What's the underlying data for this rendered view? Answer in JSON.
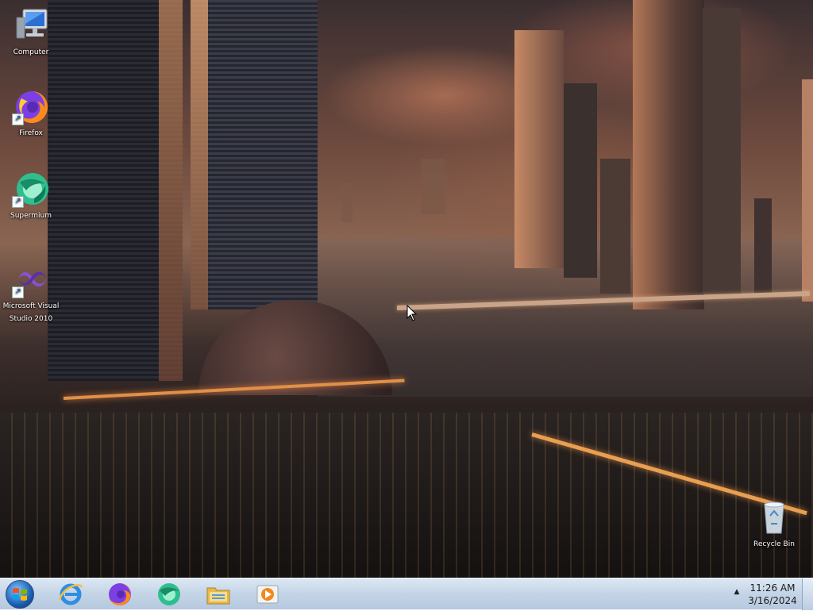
{
  "desktop": {
    "icons": [
      {
        "label": "Computer",
        "icon": "computer-icon"
      },
      {
        "label": "Firefox",
        "icon": "firefox-icon"
      },
      {
        "label": "Supermium",
        "icon": "supermium-icon"
      },
      {
        "label": "Microsoft Visual Studio 2010",
        "icon": "visual-studio-icon"
      },
      {
        "label": "Recycle Bin",
        "icon": "recycle-bin-icon"
      }
    ]
  },
  "taskbar": {
    "start_icon": "windows-start-icon",
    "pinned": [
      {
        "name": "Internet Explorer",
        "icon": "internet-explorer-icon"
      },
      {
        "name": "Firefox",
        "icon": "firefox-icon"
      },
      {
        "name": "Supermium",
        "icon": "supermium-icon"
      },
      {
        "name": "Windows Explorer",
        "icon": "folder-icon"
      },
      {
        "name": "Media Player",
        "icon": "media-player-icon"
      }
    ],
    "tray_arrow": "▲",
    "clock": {
      "time": "11:26 AM",
      "date": "3/16/2024"
    }
  },
  "colors": {
    "taskbar": "#c6d6e8",
    "start_button": "#1a5fb4"
  }
}
